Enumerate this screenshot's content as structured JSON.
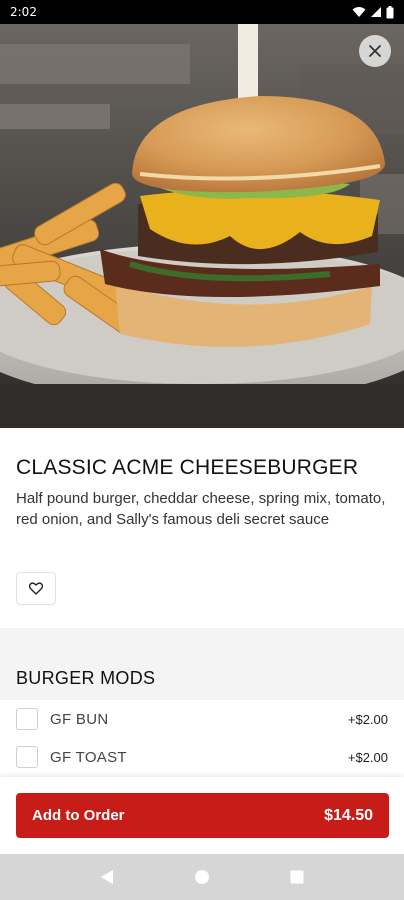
{
  "status_bar": {
    "time": "2:02"
  },
  "item": {
    "title": "CLASSIC ACME CHEESEBURGER",
    "description": "Half pound burger, cheddar cheese, spring mix, tomato, red onion, and Sally's famous deli secret sauce"
  },
  "section": {
    "title": "BURGER MODS"
  },
  "mods": [
    {
      "label": "GF BUN",
      "price": "+$2.00",
      "checked": false
    },
    {
      "label": "GF TOAST",
      "price": "+$2.00",
      "checked": false
    }
  ],
  "order": {
    "button_label": "Add to Order",
    "price": "$14.50"
  },
  "colors": {
    "accent": "#c71c18",
    "nav_bar": "#d6d6d6",
    "section_bg": "#f4f4f4"
  },
  "icons": {
    "close": "close-icon",
    "favorite": "heart-outline-icon",
    "back": "nav-back-icon",
    "home": "nav-home-icon",
    "recents": "nav-recents-icon"
  }
}
